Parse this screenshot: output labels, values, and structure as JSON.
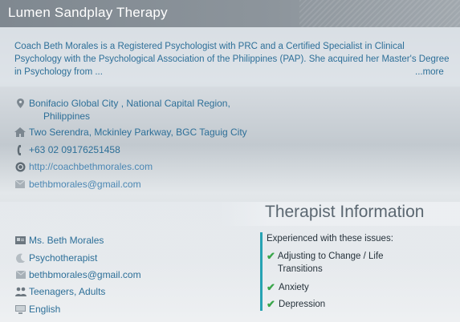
{
  "header": {
    "title": "Lumen Sandplay Therapy"
  },
  "about": {
    "bio": "Coach Beth Morales is a Registered Psychologist with PRC and a Certified Specialist in Clinical Psychology with the Psychological Association of the Philippines (PAP). She acquired her Master's Degree in Psychology from ...",
    "more_label": "...more"
  },
  "contact": {
    "region_line1": "Bonifacio Global City , National Capital Region,",
    "region_line2": "Philippines",
    "address": "Two Serendra, Mckinley Parkway, BGC Taguig City",
    "phone": "+63 02 09176251458",
    "website": "http://coachbethmorales.com",
    "email": "bethbmorales@gmail.com"
  },
  "therapist": {
    "section_title": "Therapist Information",
    "name": "Ms. Beth Morales",
    "profession": "Psychotherapist",
    "email": "bethbmorales@gmail.com",
    "age_groups": "Teenagers, Adults",
    "language": "English"
  },
  "issues": {
    "heading": "Experienced with these issues:",
    "items": [
      "Adjusting to Change / Life Transitions",
      "Anxiety",
      "Depression"
    ]
  },
  "colors": {
    "header": "#8d959c",
    "link": "#2d6f98",
    "accent_bar": "#27a3b3",
    "check": "#3aa64a"
  }
}
